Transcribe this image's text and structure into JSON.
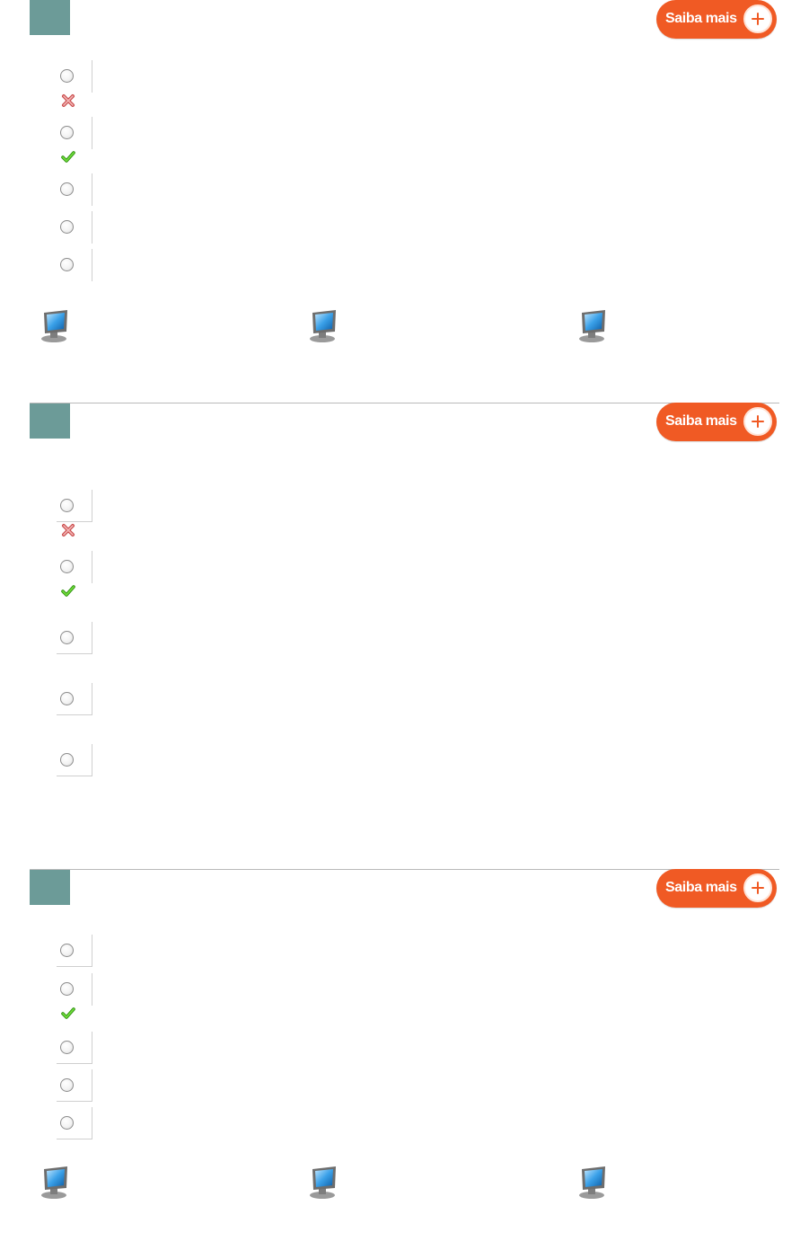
{
  "questions": [
    {
      "saiba_mais": "Saiba mais",
      "options": [
        {
          "state": "unselected",
          "feedback": "incorrect"
        },
        {
          "state": "unselected",
          "feedback": "correct"
        },
        {
          "state": "unselected",
          "feedback": "none"
        },
        {
          "state": "unselected",
          "feedback": "none"
        },
        {
          "state": "unselected",
          "feedback": "none"
        }
      ],
      "media": [
        {
          "icon": "computer-icon"
        },
        {
          "icon": "computer-icon"
        },
        {
          "icon": "computer-icon"
        }
      ]
    },
    {
      "saiba_mais": "Saiba mais",
      "options": [
        {
          "state": "unselected",
          "feedback": "incorrect"
        },
        {
          "state": "unselected",
          "feedback": "correct"
        },
        {
          "state": "unselected",
          "feedback": "none"
        },
        {
          "state": "unselected",
          "feedback": "none"
        },
        {
          "state": "unselected",
          "feedback": "none"
        }
      ],
      "media": []
    },
    {
      "saiba_mais": "Saiba mais",
      "options": [
        {
          "state": "unselected",
          "feedback": "none"
        },
        {
          "state": "unselected",
          "feedback": "correct"
        },
        {
          "state": "unselected",
          "feedback": "none"
        },
        {
          "state": "unselected",
          "feedback": "none"
        },
        {
          "state": "unselected",
          "feedback": "none"
        }
      ],
      "media": [
        {
          "icon": "computer-icon"
        },
        {
          "icon": "computer-icon"
        },
        {
          "icon": "computer-icon"
        }
      ]
    }
  ],
  "colors": {
    "accent": "#f05a24",
    "question_badge": "#6c9b98",
    "correct": "#4fbf1f",
    "incorrect": "#d96a6a"
  }
}
